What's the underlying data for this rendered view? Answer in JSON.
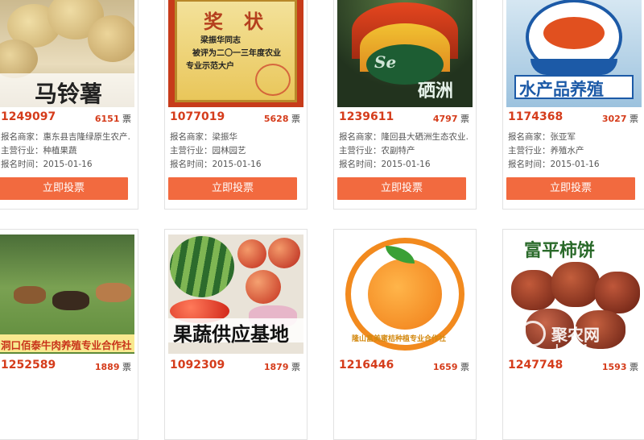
{
  "labels": {
    "merchant": "报名商家：",
    "industry": "主营行业：",
    "time": "报名时间：",
    "vote_unit": "票"
  },
  "cards": [
    {
      "id": "1249097",
      "votes": "6151",
      "merchant": "惠东县吉隆绿原生农产…",
      "industry": "种植果蔬",
      "time": "2015-01-16",
      "btn": "立即投票",
      "thumb_text": "马铃薯"
    },
    {
      "id": "1077019",
      "votes": "5628",
      "merchant": "梁振华",
      "industry": "园林园艺",
      "time": "2015-01-16",
      "btn": "立即投票",
      "thumb_text": "奖状",
      "thumb_text2": "梁振华同志",
      "thumb_text3": "被评为二〇一三年度农业",
      "thumb_text4": "专业示范大户"
    },
    {
      "id": "1239611",
      "votes": "4797",
      "merchant": "隆回县大硒洲生态农业…",
      "industry": "农副特产",
      "time": "2015-01-16",
      "btn": "立即投票",
      "thumb_text": "硒洲",
      "thumb_text2": "Se"
    },
    {
      "id": "1174368",
      "votes": "3027",
      "merchant": "张亚军",
      "industry": "养殖水产",
      "time": "2015-01-16",
      "btn": "立即投票",
      "thumb_text": "水产品养殖"
    },
    {
      "id": "1252589",
      "votes": "1889",
      "thumb_text": "洞口佰泰牛肉养殖专业合作社"
    },
    {
      "id": "1092309",
      "votes": "1879",
      "thumb_text": "果蔬供应基地"
    },
    {
      "id": "1216446",
      "votes": "1659",
      "thumb_text": "隆山富美蜜桔种植专业合作社"
    },
    {
      "id": "1247748",
      "votes": "1593",
      "thumb_text": "富平柿饼"
    }
  ],
  "watermark": {
    "text": "聚农网",
    "sub": "J…COM"
  },
  "colors": {
    "accent": "#d53c1b",
    "button": "#f26a3f"
  }
}
